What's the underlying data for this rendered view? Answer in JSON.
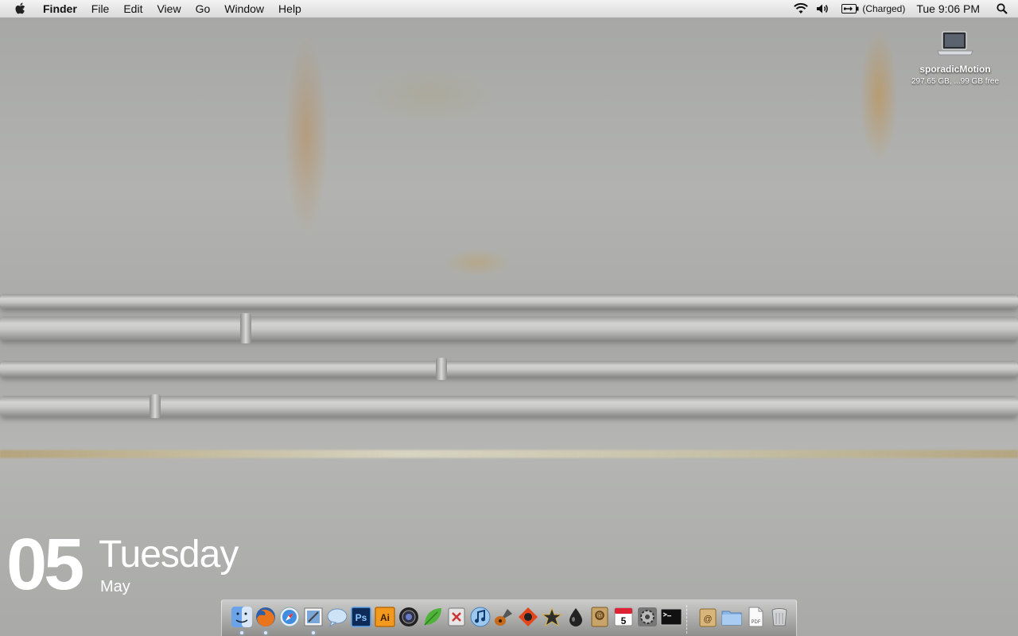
{
  "menubar": {
    "app_name": "Finder",
    "menus": [
      "File",
      "Edit",
      "View",
      "Go",
      "Window",
      "Help"
    ],
    "battery_status": "(Charged)",
    "clock": "Tue 9:06 PM",
    "icons": [
      "apple-icon",
      "wifi-icon",
      "volume-icon",
      "battery-icon",
      "spotlight-icon"
    ]
  },
  "desktop": {
    "drive_name": "sporadicMotion",
    "drive_info": "297.65 GB, ...99 GB free"
  },
  "date_widget": {
    "day": "05",
    "weekday": "Tuesday",
    "month": "May"
  },
  "dock": {
    "apps": [
      {
        "name": "finder-icon",
        "running": true
      },
      {
        "name": "firefox-icon",
        "running": true
      },
      {
        "name": "safari-icon",
        "running": false
      },
      {
        "name": "preview-icon",
        "running": true
      },
      {
        "name": "ichat-icon",
        "running": false
      },
      {
        "name": "photoshop-icon",
        "running": false,
        "label": "Ps"
      },
      {
        "name": "illustrator-icon",
        "running": false,
        "label": "Ai"
      },
      {
        "name": "aperture-icon",
        "running": false
      },
      {
        "name": "leaf-icon",
        "running": false
      },
      {
        "name": "utility-icon",
        "running": false
      },
      {
        "name": "itunes-icon",
        "running": false
      },
      {
        "name": "garageband-icon",
        "running": false
      },
      {
        "name": "reason-icon",
        "running": false
      },
      {
        "name": "imovie-star-icon",
        "running": false
      },
      {
        "name": "droplet-icon",
        "running": false
      },
      {
        "name": "address-book-icon",
        "running": false
      },
      {
        "name": "ical-icon",
        "running": false,
        "label": "5"
      },
      {
        "name": "system-preferences-icon",
        "running": false
      },
      {
        "name": "terminal-icon",
        "running": false
      }
    ],
    "stacks": [
      {
        "name": "documents-stack-icon"
      },
      {
        "name": "folder-stack-icon"
      },
      {
        "name": "pdf-document-icon",
        "label": "PDF"
      },
      {
        "name": "trash-icon"
      }
    ]
  }
}
